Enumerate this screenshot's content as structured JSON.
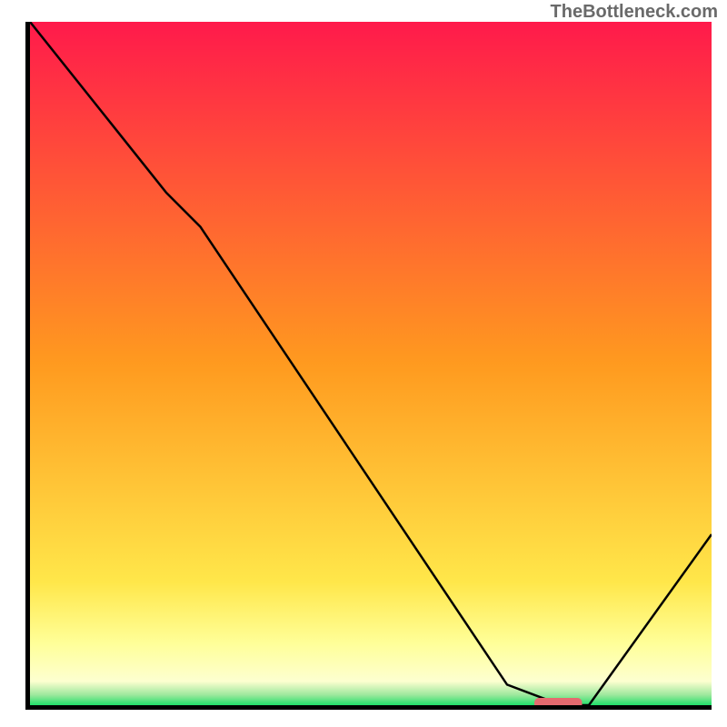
{
  "watermark": "TheBottleneck.com",
  "chart_data": {
    "type": "line",
    "title": "",
    "xlabel": "",
    "ylabel": "",
    "xlim": [
      0,
      100
    ],
    "ylim": [
      0,
      100
    ],
    "series": [
      {
        "name": "curve",
        "x": [
          0,
          20,
          25,
          70,
          78,
          82,
          100
        ],
        "y": [
          100,
          75,
          70,
          3,
          0,
          0,
          25
        ]
      }
    ],
    "marker": {
      "x_start": 74,
      "x_end": 81,
      "y": 0,
      "color": "#e56a6f"
    },
    "background_gradient": {
      "stops": [
        {
          "offset": 0.0,
          "color": "#ff1a4b"
        },
        {
          "offset": 0.5,
          "color": "#ff9a1f"
        },
        {
          "offset": 0.82,
          "color": "#ffe74a"
        },
        {
          "offset": 0.91,
          "color": "#ffff99"
        },
        {
          "offset": 0.965,
          "color": "#fdffd0"
        },
        {
          "offset": 0.985,
          "color": "#9de89d"
        },
        {
          "offset": 1.0,
          "color": "#1fe06a"
        }
      ]
    }
  }
}
